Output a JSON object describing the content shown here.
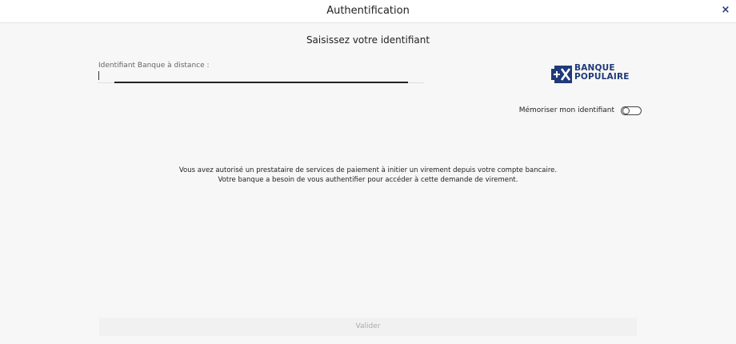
{
  "header": {
    "title": "Authentification",
    "close_glyph": "×"
  },
  "form": {
    "subtitle": "Saisissez votre identifiant",
    "field_label": "Identifiant Banque à distance :",
    "field_value": "",
    "remember_label": "Mémoriser mon identifiant",
    "remember_on": false
  },
  "brand": {
    "line1": "BANQUE",
    "line2": "POPULAIRE",
    "color": "#1f3a78",
    "icon": "plus-x-logo-icon"
  },
  "info": {
    "line1": "Vous avez autorisé un prestataire de services de paiement à initier un virement depuis votre compte bancaire.",
    "line2": "Votre banque a besoin de vous authentifier pour accéder à cette demande de virement."
  },
  "actions": {
    "validate_label": "Valider"
  }
}
